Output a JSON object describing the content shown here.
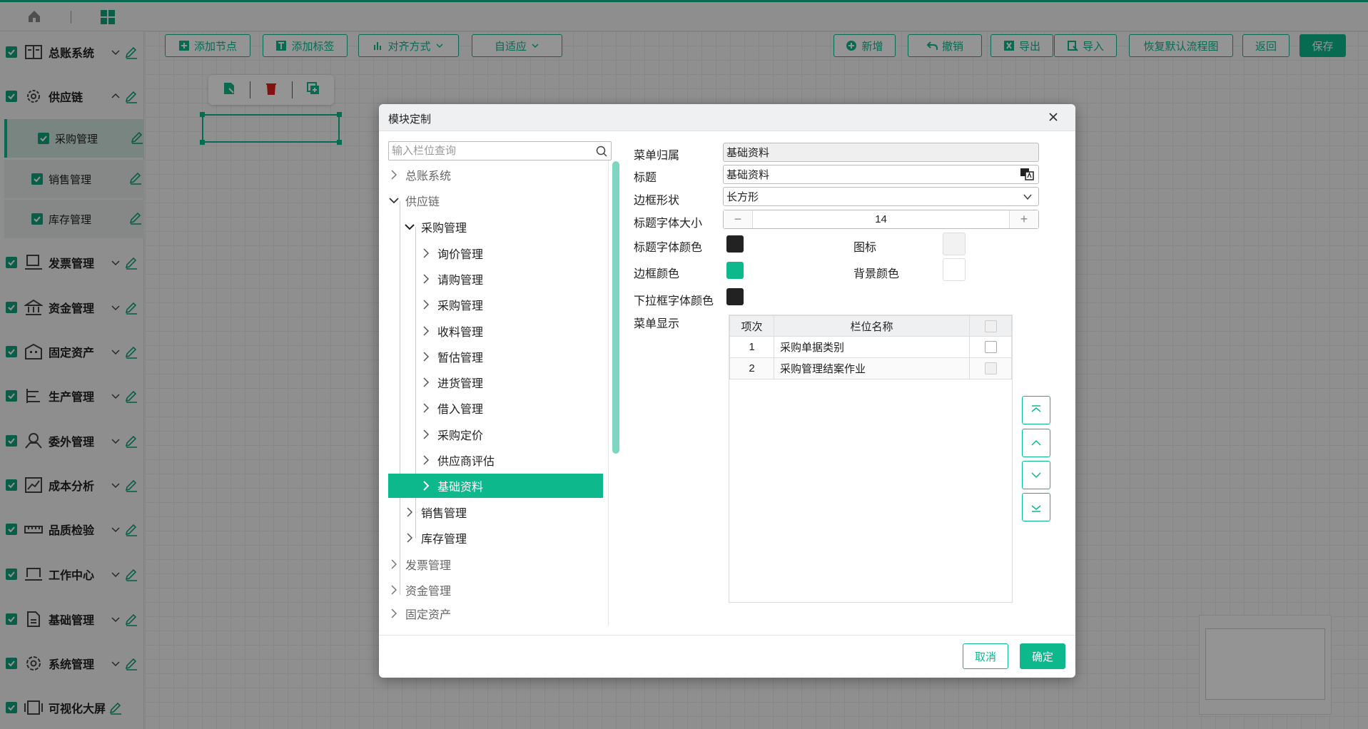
{
  "theme": {
    "accent": "#0db88d",
    "dark_swatch": "#222222"
  },
  "sidebar": {
    "items": [
      {
        "label": "总账系统",
        "icon": "ledger-icon"
      },
      {
        "label": "供应链",
        "icon": "gears-icon"
      },
      {
        "label": "发票管理",
        "icon": "invoice-icon"
      },
      {
        "label": "资金管理",
        "icon": "bank-icon"
      },
      {
        "label": "固定资产",
        "icon": "building-icon"
      },
      {
        "label": "生产管理",
        "icon": "production-icon"
      },
      {
        "label": "委外管理",
        "icon": "handshake-icon"
      },
      {
        "label": "成本分析",
        "icon": "chart-icon"
      },
      {
        "label": "品质检验",
        "icon": "ruler-icon"
      },
      {
        "label": "工作中心",
        "icon": "workcenter-icon"
      },
      {
        "label": "基础管理",
        "icon": "document-icon"
      },
      {
        "label": "系统管理",
        "icon": "settings-icon"
      },
      {
        "label": "可视化大屏",
        "icon": "screen-icon"
      }
    ],
    "subitems": [
      {
        "label": "采购管理"
      },
      {
        "label": "销售管理"
      },
      {
        "label": "库存管理"
      }
    ]
  },
  "toolbar": {
    "add_node": "添加节点",
    "add_label": "添加标签",
    "align": "对齐方式",
    "fit": "自适应",
    "new": "新增",
    "undo": "撤销",
    "export": "导出",
    "import": "导入",
    "restore": "恢复默认流程图",
    "back": "返回",
    "save": "保存"
  },
  "dialog": {
    "title": "模块定制",
    "search_placeholder": "输入栏位查询",
    "tree": {
      "n1": "总账系统",
      "n2": "供应链",
      "n3": "采购管理",
      "c1": "询价管理",
      "c2": "请购管理",
      "c3": "采购管理",
      "c4": "收料管理",
      "c5": "暂估管理",
      "c6": "进货管理",
      "c7": "借入管理",
      "c8": "采购定价",
      "c9": "供应商评估",
      "c10": "基础资料",
      "n4": "销售管理",
      "n5": "库存管理",
      "n6": "发票管理",
      "n7": "资金管理",
      "n8": "固定资产"
    },
    "form": {
      "menu_owner_label": "菜单归属",
      "menu_owner_value": "基础资料",
      "title_label": "标题",
      "title_value": "基础资料",
      "border_shape_label": "边框形状",
      "border_shape_value": "长方形",
      "font_size_label": "标题字体大小",
      "font_size_value": "14",
      "font_color_label": "标题字体颜色",
      "icon_label": "图标",
      "border_color_label": "边框颜色",
      "bg_color_label": "背景颜色",
      "dropdown_color_label": "下拉框字体颜色",
      "menu_display_label": "菜单显示"
    },
    "grid": {
      "col_index": "项次",
      "col_name": "栏位名称",
      "rows": [
        {
          "idx": "1",
          "name": "采购单据类别"
        },
        {
          "idx": "2",
          "name": "采购管理结案作业"
        }
      ]
    },
    "cancel": "取消",
    "ok": "确定"
  }
}
